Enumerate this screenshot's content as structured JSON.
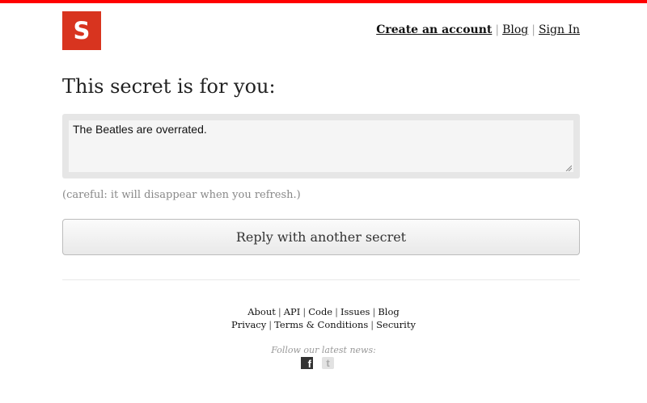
{
  "brand": {
    "logo_letter": "S",
    "accent_color": "#d8341f",
    "topbar_color": "#ff0000"
  },
  "nav": {
    "create_account": "Create an account",
    "blog": "Blog",
    "sign_in": "Sign In",
    "separator": "|"
  },
  "main": {
    "title": "This secret is for you:",
    "secret_text": "The Beatles are overrated.",
    "note": "(careful: it will disappear when you refresh.)",
    "reply_button": "Reply with another secret"
  },
  "footer": {
    "row1": [
      "About",
      "API",
      "Code",
      "Issues",
      "Blog"
    ],
    "row2": [
      "Privacy",
      "Terms & Conditions",
      "Security"
    ],
    "separator": "|",
    "follow_label": "Follow our latest news:",
    "facebook_glyph": "f",
    "twitter_glyph": "t",
    "social_icons": [
      "facebook-icon",
      "twitter-icon"
    ]
  }
}
